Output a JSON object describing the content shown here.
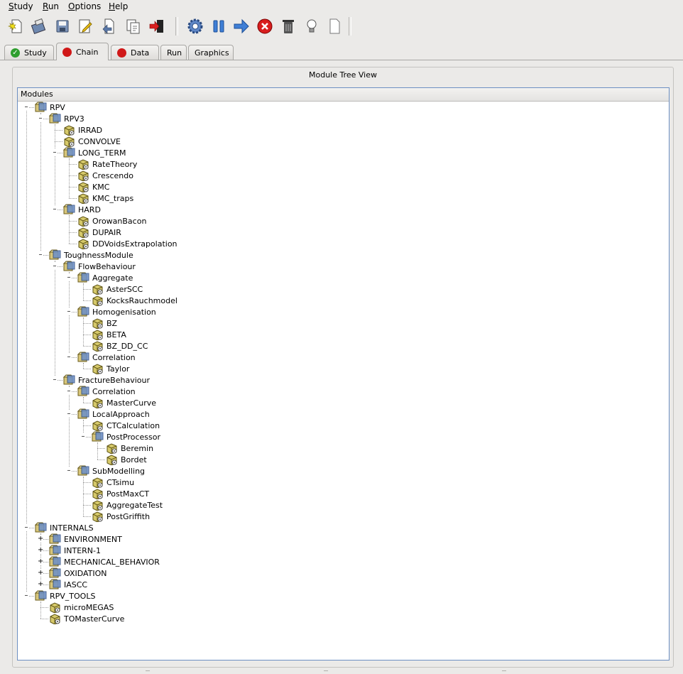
{
  "menu": [
    "Study",
    "Run",
    "Options",
    "Help"
  ],
  "toolbar_icons": [
    "new-icon",
    "save-as-icon",
    "save-icon",
    "edit-icon",
    "import-icon",
    "copy-icon",
    "exit-icon",
    "settings-gear-icon",
    "pause-icon",
    "run-arrow-icon",
    "stop-icon",
    "trash-icon",
    "lightbulb-icon",
    "blank-page-icon"
  ],
  "tabs": [
    {
      "label": "Study",
      "status": "ok"
    },
    {
      "label": "Chain",
      "status": "error"
    },
    {
      "label": "Data",
      "status": "error"
    },
    {
      "label": "Run",
      "status": "none"
    },
    {
      "label": "Graphics",
      "status": "none"
    }
  ],
  "active_tab": "Chain",
  "colors": {
    "ok": "#2e9e2e",
    "error": "#d01818",
    "accent_border": "#6c8fc2"
  },
  "panel_title": "Module Tree View",
  "tree_header": "Modules",
  "tree": [
    {
      "label": "RPV",
      "depth": 0,
      "type": "folder",
      "state": "expanded"
    },
    {
      "label": "RPV3",
      "depth": 1,
      "type": "folder",
      "state": "expanded"
    },
    {
      "label": "IRRAD",
      "depth": 2,
      "type": "module"
    },
    {
      "label": "CONVOLVE",
      "depth": 2,
      "type": "module"
    },
    {
      "label": "LONG_TERM",
      "depth": 2,
      "type": "folder",
      "state": "expanded"
    },
    {
      "label": "RateTheory",
      "depth": 3,
      "type": "module"
    },
    {
      "label": "Crescendo",
      "depth": 3,
      "type": "module"
    },
    {
      "label": "KMC",
      "depth": 3,
      "type": "module"
    },
    {
      "label": "KMC_traps",
      "depth": 3,
      "type": "module"
    },
    {
      "label": "HARD",
      "depth": 2,
      "type": "folder",
      "state": "expanded"
    },
    {
      "label": "OrowanBacon",
      "depth": 3,
      "type": "module"
    },
    {
      "label": "DUPAIR",
      "depth": 3,
      "type": "module"
    },
    {
      "label": "DDVoidsExtrapolation",
      "depth": 3,
      "type": "module"
    },
    {
      "label": "ToughnessModule",
      "depth": 1,
      "type": "folder",
      "state": "expanded"
    },
    {
      "label": "FlowBehaviour",
      "depth": 2,
      "type": "folder",
      "state": "expanded"
    },
    {
      "label": "Aggregate",
      "depth": 3,
      "type": "folder",
      "state": "expanded"
    },
    {
      "label": "AsterSCC",
      "depth": 4,
      "type": "module"
    },
    {
      "label": "KocksRauchmodel",
      "depth": 4,
      "type": "module"
    },
    {
      "label": "Homogenisation",
      "depth": 3,
      "type": "folder",
      "state": "expanded"
    },
    {
      "label": "BZ",
      "depth": 4,
      "type": "module"
    },
    {
      "label": "BETA",
      "depth": 4,
      "type": "module"
    },
    {
      "label": "BZ_DD_CC",
      "depth": 4,
      "type": "module"
    },
    {
      "label": "Correlation",
      "depth": 3,
      "type": "folder",
      "state": "expanded"
    },
    {
      "label": "Taylor",
      "depth": 4,
      "type": "module"
    },
    {
      "label": "FractureBehaviour",
      "depth": 2,
      "type": "folder",
      "state": "expanded"
    },
    {
      "label": "Correlation",
      "depth": 3,
      "type": "folder",
      "state": "expanded"
    },
    {
      "label": "MasterCurve",
      "depth": 4,
      "type": "module"
    },
    {
      "label": "LocalApproach",
      "depth": 3,
      "type": "folder",
      "state": "expanded"
    },
    {
      "label": "CTCalculation",
      "depth": 4,
      "type": "module"
    },
    {
      "label": "PostProcessor",
      "depth": 4,
      "type": "folder",
      "state": "expanded"
    },
    {
      "label": "Beremin",
      "depth": 5,
      "type": "module"
    },
    {
      "label": "Bordet",
      "depth": 5,
      "type": "module"
    },
    {
      "label": "SubModelling",
      "depth": 3,
      "type": "folder",
      "state": "expanded"
    },
    {
      "label": "CTsimu",
      "depth": 4,
      "type": "module"
    },
    {
      "label": "PostMaxCT",
      "depth": 4,
      "type": "module"
    },
    {
      "label": "AggregateTest",
      "depth": 4,
      "type": "module"
    },
    {
      "label": "PostGriffith",
      "depth": 4,
      "type": "module"
    },
    {
      "label": "INTERNALS",
      "depth": 0,
      "type": "folder",
      "state": "expanded"
    },
    {
      "label": "ENVIRONMENT",
      "depth": 1,
      "type": "folder",
      "state": "collapsed"
    },
    {
      "label": "INTERN-1",
      "depth": 1,
      "type": "folder",
      "state": "collapsed"
    },
    {
      "label": "MECHANICAL_BEHAVIOR",
      "depth": 1,
      "type": "folder",
      "state": "collapsed"
    },
    {
      "label": "OXIDATION",
      "depth": 1,
      "type": "folder",
      "state": "collapsed"
    },
    {
      "label": "IASCC",
      "depth": 1,
      "type": "folder",
      "state": "collapsed"
    },
    {
      "label": "RPV_TOOLS",
      "depth": 0,
      "type": "folder",
      "state": "expanded"
    },
    {
      "label": "microMEGAS",
      "depth": 1,
      "type": "module"
    },
    {
      "label": "TOMasterCurve",
      "depth": 1,
      "type": "module"
    }
  ]
}
